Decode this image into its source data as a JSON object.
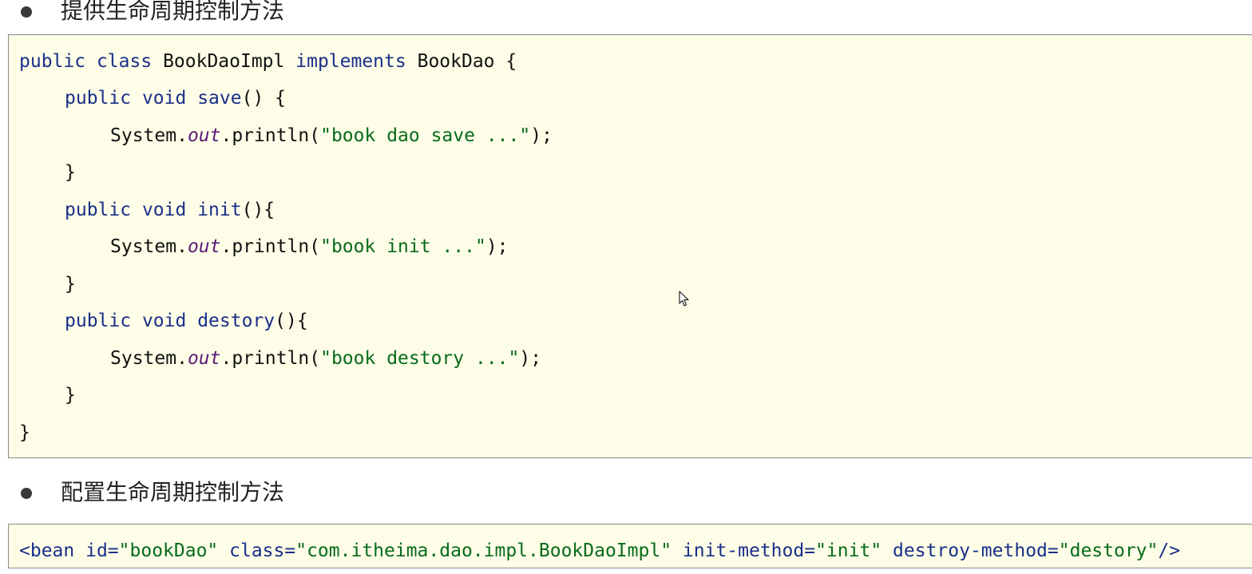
{
  "section1": {
    "heading": "提供生命周期控制方法"
  },
  "code1": {
    "l1_kw1": "public",
    "l1_kw2": "class",
    "l1_name": "BookDaoImpl",
    "l1_kw3": "implements",
    "l1_iface": "BookDao {",
    "l2_kw1": "public",
    "l2_kw2": "void",
    "l2_fn": "save",
    "l2_rest": "() {",
    "l3_obj": "System.",
    "l3_field": "out",
    "l3_call": ".println(",
    "l3_str": "\"book dao save ...\"",
    "l3_end": ");",
    "l4": "}",
    "l5_kw1": "public",
    "l5_kw2": "void",
    "l5_fn": "init",
    "l5_rest": "(){",
    "l6_obj": "System.",
    "l6_field": "out",
    "l6_call": ".println(",
    "l6_str": "\"book init ...\"",
    "l6_end": ");",
    "l7": "}",
    "l8_kw1": "public",
    "l8_kw2": "void",
    "l8_fn": "destory",
    "l8_rest": "(){",
    "l9_obj": "System.",
    "l9_field": "out",
    "l9_call": ".println(",
    "l9_str": "\"book destory ...\"",
    "l9_end": ");",
    "l10": "}",
    "l11": "}"
  },
  "section2": {
    "heading": "配置生命周期控制方法"
  },
  "code2": {
    "tag_open": "<bean",
    "a1": "id=",
    "v1": "\"bookDao\"",
    "a2": "class=",
    "v2": "\"com.itheima.dao.impl.BookDaoImpl\"",
    "a3": "init-method=",
    "v3": "\"init\"",
    "a4": "destroy-method=",
    "v4": "\"destory\"",
    "tag_close": "/>"
  }
}
